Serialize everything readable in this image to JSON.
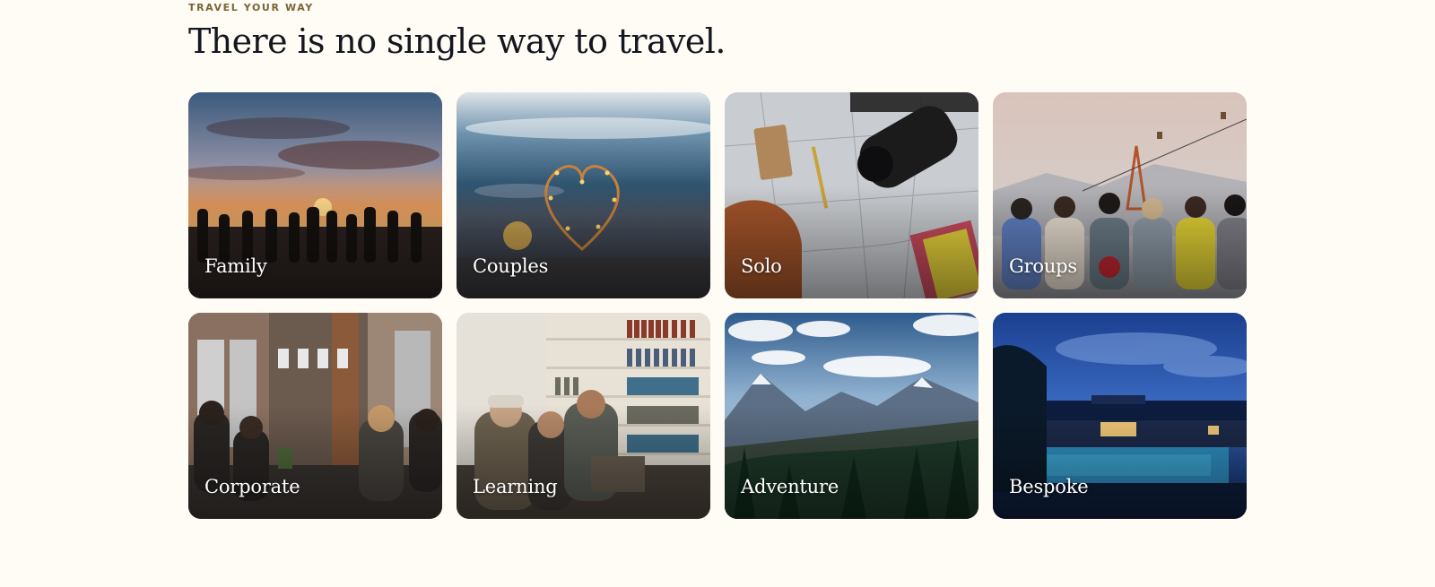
{
  "section": {
    "eyebrow": "TRAVEL YOUR WAY",
    "title": "There is no single way to travel."
  },
  "cards": [
    {
      "label": "Family",
      "image": "family-sunset-beach"
    },
    {
      "label": "Couples",
      "image": "heart-fairy-lights"
    },
    {
      "label": "Solo",
      "image": "map-camera-notebook"
    },
    {
      "label": "Groups",
      "image": "friends-arms-around-shoulders"
    },
    {
      "label": "Corporate",
      "image": "team-meeting-table"
    },
    {
      "label": "Learning",
      "image": "students-library-laptop"
    },
    {
      "label": "Adventure",
      "image": "mountain-valley-forest"
    },
    {
      "label": "Bespoke",
      "image": "luxury-resort-pool-night"
    }
  ],
  "colors": {
    "page_background": "#fffcf6",
    "eyebrow": "#7a6436",
    "heading": "#15171f",
    "card_label": "#ffffff"
  }
}
